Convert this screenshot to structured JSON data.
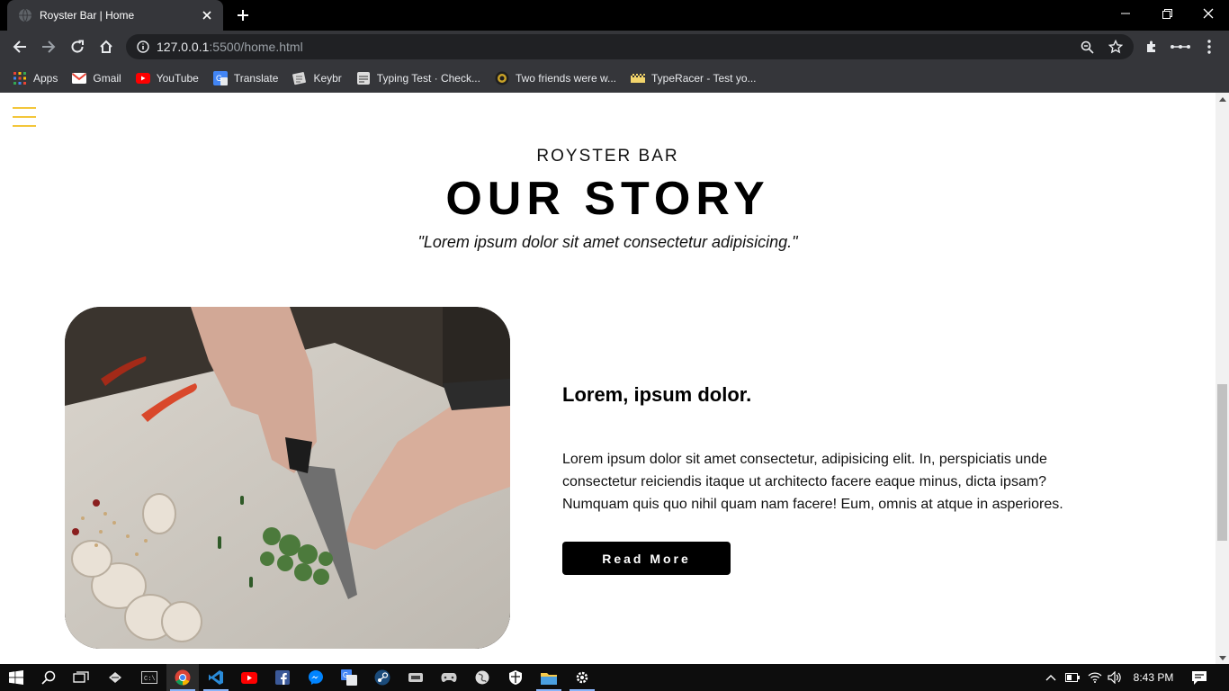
{
  "browser": {
    "tab_title": "Royster Bar | Home",
    "url_host": "127.0.0.1",
    "url_rest": ":5500/home.html",
    "bookmarks": [
      {
        "label": "Apps",
        "icon": "apps-grid-icon"
      },
      {
        "label": "Gmail",
        "icon": "gmail-icon"
      },
      {
        "label": "YouTube",
        "icon": "youtube-icon"
      },
      {
        "label": "Translate",
        "icon": "translate-icon"
      },
      {
        "label": "Keybr",
        "icon": "keybr-icon"
      },
      {
        "label": "Typing Test · Check...",
        "icon": "typing-test-icon"
      },
      {
        "label": "Two friends were w...",
        "icon": "two-friends-icon"
      },
      {
        "label": "TypeRacer - Test yo...",
        "icon": "typeracer-icon"
      }
    ]
  },
  "page": {
    "eyebrow": "ROYSTER BAR",
    "headline": "OUR STORY",
    "quote": "\"Lorem ipsum dolor sit amet consectetur adipisicing.\"",
    "story_title": "Lorem, ipsum dolor.",
    "story_body": "Lorem ipsum dolor sit amet consectetur, adipisicing elit. In, perspiciatis unde consectetur reiciendis itaque ut architecto facere eaque minus, dicta ipsam? Numquam quis quo nihil quam nam facere! Eum, omnis at atque in asperiores.",
    "read_more": "Read More",
    "accent_color": "#f3c63a"
  },
  "taskbar": {
    "time": "8:43 PM"
  }
}
